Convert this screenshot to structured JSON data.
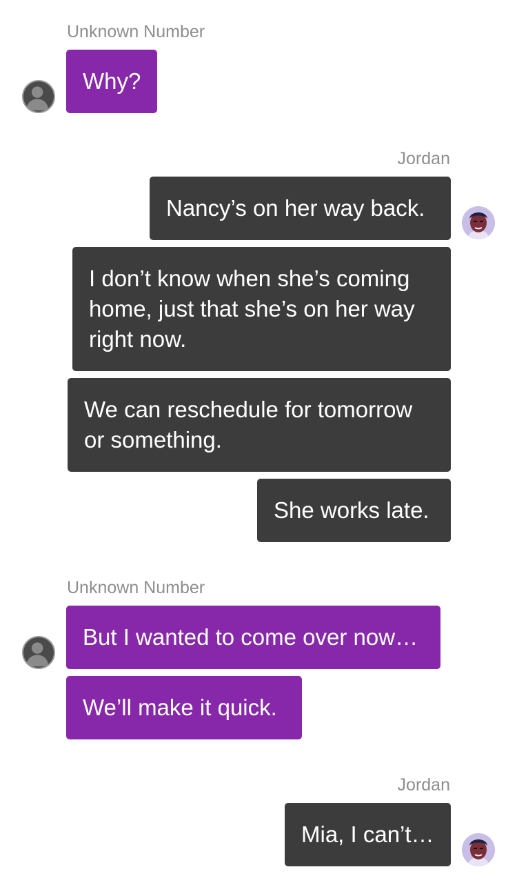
{
  "conversation": [
    {
      "sender": "Unknown Number",
      "side": "left",
      "avatar": "unknown-user-icon",
      "messages": [
        "Why?"
      ]
    },
    {
      "sender": "Jordan",
      "side": "right",
      "avatar": "jordan-avatar",
      "messages": [
        "Nancy’s on her way back.",
        "I don’t know when she’s coming home, just that she’s on her way right now.",
        "We can reschedule for tomorrow or something.",
        "She works late."
      ]
    },
    {
      "sender": "Unknown Number",
      "side": "left",
      "avatar": "unknown-user-icon",
      "messages": [
        "But I wanted to come over now…",
        "We’ll make it quick."
      ]
    },
    {
      "sender": "Jordan",
      "side": "right",
      "avatar": "jordan-avatar",
      "messages": [
        "Mia, I can’t…"
      ]
    }
  ],
  "colors": {
    "incoming_bubble": "#8628a9",
    "outgoing_bubble": "#3c3c3c",
    "sender_name": "#8e8e8e",
    "bubble_text": "#ffffff",
    "background": "#ffffff"
  }
}
